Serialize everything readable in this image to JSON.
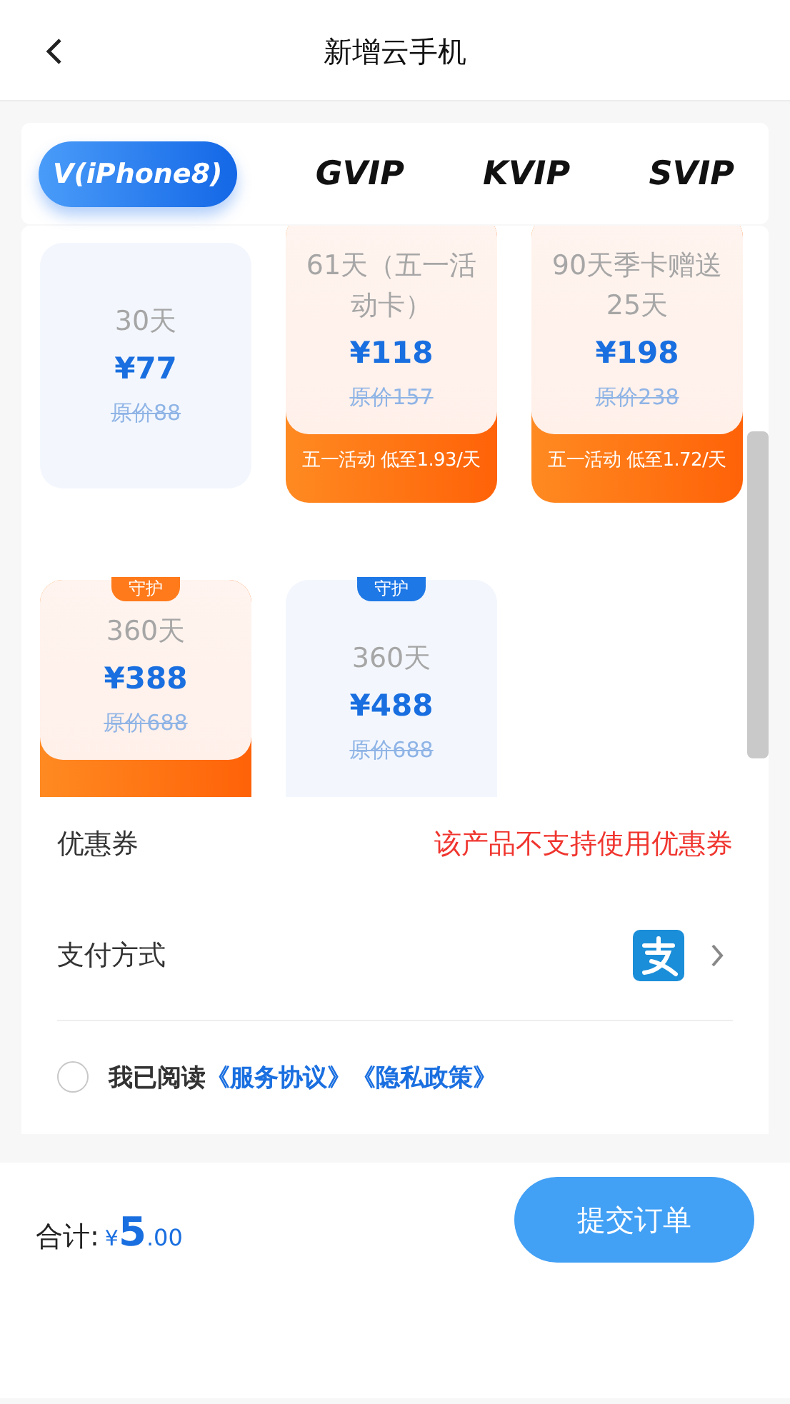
{
  "header": {
    "title": "新增云手机"
  },
  "tabs": [
    {
      "label": "V(iPhone8)",
      "selected": true
    },
    {
      "label": "GVIP",
      "selected": false
    },
    {
      "label": "KVIP",
      "selected": false
    },
    {
      "label": "SVIP",
      "selected": false
    }
  ],
  "packages": [
    {
      "kind": "plain",
      "duration": "30天",
      "price": "¥77",
      "original": "原价88"
    },
    {
      "kind": "promo",
      "duration": "61天（五一活动卡）",
      "price": "¥118",
      "original": "原价157",
      "promo": "五一活动 低至1.93/天"
    },
    {
      "kind": "promo",
      "duration": "90天季卡赠送25天",
      "price": "¥198",
      "original": "原价238",
      "promo": "五一活动 低至1.72/天"
    },
    {
      "kind": "promo",
      "duration": "360天",
      "price": "¥388",
      "original": "原价688",
      "badge": {
        "label": "守护",
        "color": "#ff7a1a"
      }
    },
    {
      "kind": "plain",
      "duration": "360天",
      "price": "¥488",
      "original": "原价688",
      "badge": {
        "label": "守护",
        "color": "#1e78e6"
      }
    }
  ],
  "coupon": {
    "label": "优惠券",
    "value": "该产品不支持使用优惠券"
  },
  "payment": {
    "label": "支付方式"
  },
  "agreement": {
    "checked": false,
    "text": "我已阅读",
    "links": [
      "《服务协议》",
      "《隐私政策》"
    ]
  },
  "footer": {
    "label": "合计:",
    "currency": "¥",
    "amount": "5",
    "decimals": ".00",
    "button": "提交订单"
  }
}
